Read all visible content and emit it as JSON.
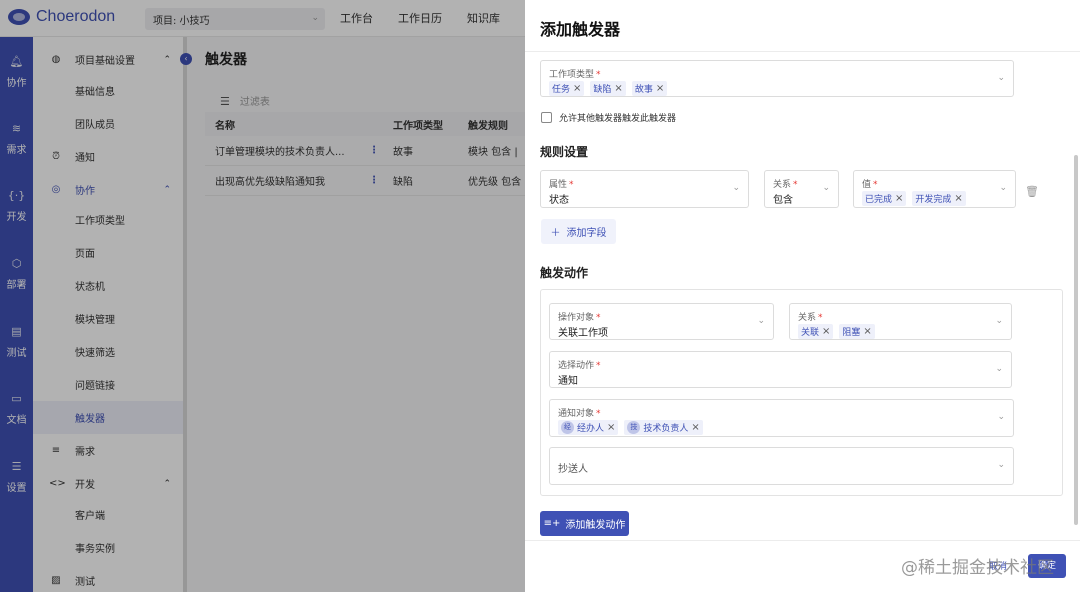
{
  "app": {
    "brand": "Choerodon",
    "project": "项目: 小技巧"
  },
  "topnav": [
    "工作台",
    "工作日历",
    "知识库"
  ],
  "leftnav": [
    {
      "label": "协作",
      "icon": "bell-icon"
    },
    {
      "label": "需求",
      "icon": "layers-icon"
    },
    {
      "label": "开发",
      "icon": "code-icon"
    },
    {
      "label": "部署",
      "icon": "deploy-icon"
    },
    {
      "label": "测试",
      "icon": "clipboard-icon"
    },
    {
      "label": "文档",
      "icon": "inbox-icon"
    },
    {
      "label": "设置",
      "icon": "settings-icon"
    }
  ],
  "menu": {
    "items": [
      {
        "label": "项目基础设置",
        "icon": "palette-icon",
        "chevron": "⌃"
      },
      {
        "label": "基础信息"
      },
      {
        "label": "团队成员"
      },
      {
        "label": "通知",
        "icon": "alarm-icon"
      },
      {
        "label": "协作",
        "icon": "collab-icon",
        "chevron": "⌃"
      },
      {
        "label": "工作项类型"
      },
      {
        "label": "页面"
      },
      {
        "label": "状态机"
      },
      {
        "label": "模块管理"
      },
      {
        "label": "快速筛选"
      },
      {
        "label": "问题链接"
      },
      {
        "label": "触发器"
      },
      {
        "label": "需求",
        "icon": "list-icon"
      },
      {
        "label": "开发",
        "icon": "code-icon",
        "chevron": "⌃"
      },
      {
        "label": "客户端"
      },
      {
        "label": "事务实例"
      },
      {
        "label": "测试",
        "icon": "test-icon"
      }
    ]
  },
  "main": {
    "title": "触发器",
    "filter_placeholder": "过滤表",
    "columns": [
      "名称",
      "工作项类型",
      "触发规则"
    ],
    "rows": [
      {
        "name": "订单管理模块的技术负责人...",
        "type": "故事",
        "rule": "模块 包含 |"
      },
      {
        "name": "出现高优先级缺陷通知我",
        "type": "缺陷",
        "rule": "优先级 包含"
      }
    ]
  },
  "panel": {
    "title": "添加触发器",
    "issue_type_label": "工作项类型",
    "issue_types": [
      "任务",
      "缺陷",
      "故事"
    ],
    "allow_other_trigger": "允许其他触发器触发此触发器",
    "rules_section": "规则设置",
    "rule": {
      "attr_label": "属性",
      "attr_value": "状态",
      "relation_label": "关系",
      "relation_value": "包含",
      "value_label": "值",
      "values": [
        "已完成",
        "开发完成"
      ]
    },
    "add_field": "添加字段",
    "actions_section": "触发动作",
    "action": {
      "target_label": "操作对象",
      "target_value": "关联工作项",
      "relation_label": "关系",
      "relations": [
        "关联",
        "阻塞"
      ],
      "action_label": "选择动作",
      "action_value": "通知",
      "notify_label": "通知对象",
      "notify": [
        {
          "avatar": "经",
          "name": "经办人"
        },
        {
          "avatar": "技",
          "name": "技术负责人"
        }
      ],
      "cc_label": "抄送人"
    },
    "add_action": "添加触发动作",
    "cancel": "取消",
    "ok": "确定"
  },
  "watermark": "@稀土掘金技术社区"
}
